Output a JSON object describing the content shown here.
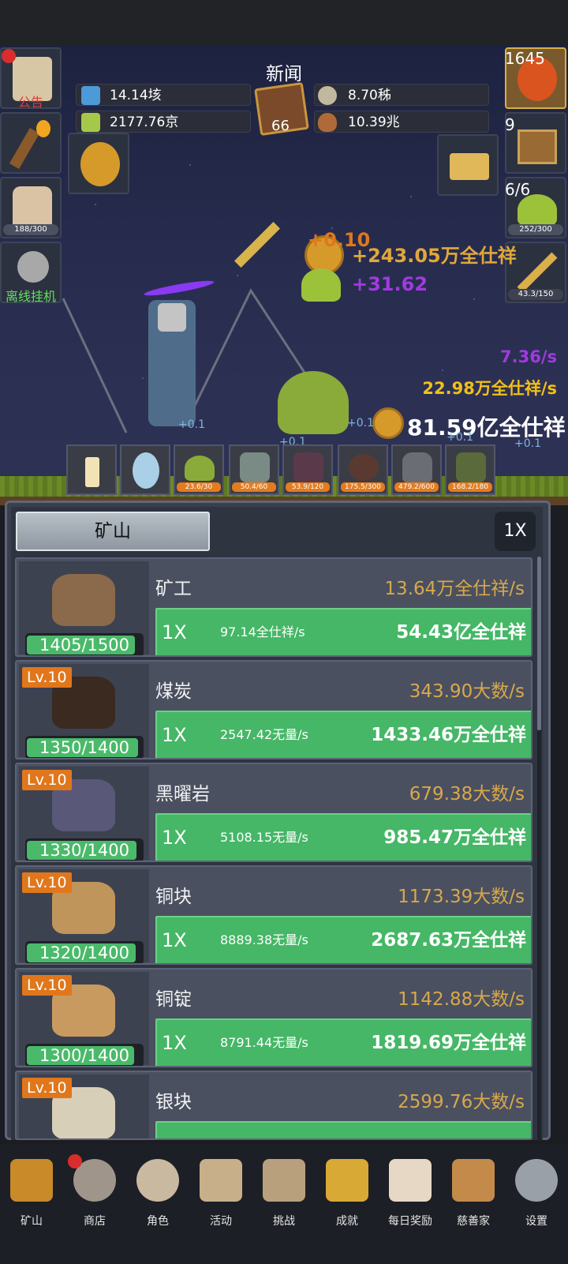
{
  "header": {
    "news_title": "新闻",
    "resources": {
      "blue_potion": "14.14垓",
      "green_potion": "2177.76京",
      "book_count": "66",
      "coin": "8.70秭",
      "meat": "10.39兆"
    }
  },
  "left_buttons": {
    "announcement": "公告",
    "drink_progress": "188/300",
    "offline": "离线挂机"
  },
  "right_buttons": {
    "potion_count": "1645",
    "chest_count": "9",
    "slime_count": "6/6",
    "slime_progress": "252/300",
    "sword_progress": "43.3/150"
  },
  "scene": {
    "float_coin_gain": "+243.05万全仕祥",
    "float_small": "+0.10",
    "float_purple": "+31.62",
    "rate_purple": "7.36/s",
    "rate_yellow": "22.98万全仕祥/s",
    "total_coins": "81.59亿全仕祥",
    "ground_labels": [
      "+0.1",
      "+0.1",
      "+0.1",
      "+0.1",
      "+0.1"
    ]
  },
  "monster_slots": [
    "23.6/30",
    "50.4/60",
    "53.9/120",
    "175.5/300",
    "479.2/600",
    "168.2/180"
  ],
  "panel": {
    "tab_label": "矿山",
    "multiplier": "1X"
  },
  "mines": [
    {
      "name": "矿工",
      "level": "",
      "progress": "1405/1500",
      "progress_value": 0.937,
      "rate": "13.64万全仕祥/s",
      "mult": "1X",
      "per_sec": "97.14全仕祥/s",
      "cost": "54.43亿全仕祥",
      "color": "#8a6a4a"
    },
    {
      "name": "煤炭",
      "level": "Lv.10",
      "progress": "1350/1400",
      "progress_value": 0.964,
      "rate": "343.90大数/s",
      "mult": "1X",
      "per_sec": "2547.42无量/s",
      "cost": "1433.46万全仕祥",
      "color": "#3a2a20"
    },
    {
      "name": "黑曜岩",
      "level": "Lv.10",
      "progress": "1330/1400",
      "progress_value": 0.95,
      "rate": "679.38大数/s",
      "mult": "1X",
      "per_sec": "5108.15无量/s",
      "cost": "985.47万全仕祥",
      "color": "#5a5878"
    },
    {
      "name": "铜块",
      "level": "Lv.10",
      "progress": "1320/1400",
      "progress_value": 0.943,
      "rate": "1173.39大数/s",
      "mult": "1X",
      "per_sec": "8889.38无量/s",
      "cost": "2687.63万全仕祥",
      "color": "#c0955c"
    },
    {
      "name": "铜锭",
      "level": "Lv.10",
      "progress": "1300/1400",
      "progress_value": 0.929,
      "rate": "1142.88大数/s",
      "mult": "1X",
      "per_sec": "8791.44无量/s",
      "cost": "1819.69万全仕祥",
      "color": "#c99a60"
    },
    {
      "name": "银块",
      "level": "Lv.10",
      "progress": "",
      "progress_value": 0,
      "rate": "2599.76大数/s",
      "mult": "",
      "per_sec": "",
      "cost": "",
      "color": "#d8cfb8"
    }
  ],
  "nav": [
    {
      "label": "矿山",
      "icon": "lantern-icon",
      "color": "#c98a2a"
    },
    {
      "label": "商店",
      "icon": "stone-icon",
      "color": "#9f958a"
    },
    {
      "label": "角色",
      "icon": "skull-icon",
      "color": "#c9b9a0"
    },
    {
      "label": "活动",
      "icon": "scroll-icon",
      "color": "#c7b089"
    },
    {
      "label": "挑战",
      "icon": "map-icon",
      "color": "#b9a07d"
    },
    {
      "label": "成就",
      "icon": "key-icon",
      "color": "#d9a935"
    },
    {
      "label": "每日奖励",
      "icon": "letter-icon",
      "color": "#e6d8c4"
    },
    {
      "label": "慈善家",
      "icon": "bread-icon",
      "color": "#c48a4a"
    },
    {
      "label": "设置",
      "icon": "gear-icon",
      "color": "#9aa0a8"
    }
  ]
}
